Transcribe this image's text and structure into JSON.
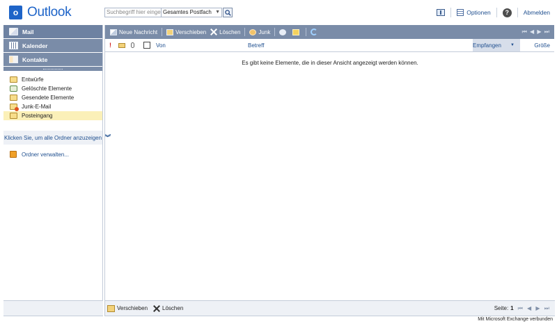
{
  "header": {
    "app_name": "Outlook",
    "logo_letter": "o",
    "search": {
      "placeholder": "Suchbegriff hier eingeben",
      "scope": "Gesamtes Postfach"
    },
    "options_label": "Optionen",
    "help_label": "?",
    "logout_label": "Abmelden"
  },
  "nav": {
    "sections": {
      "mail": "Mail",
      "calendar": "Kalender",
      "contacts": "Kontakte"
    },
    "folders": [
      {
        "label": "Entwürfe"
      },
      {
        "label": "Gelöschte Elemente"
      },
      {
        "label": "Gesendete Elemente"
      },
      {
        "label": "Junk-E-Mail"
      },
      {
        "label": "Posteingang",
        "selected": true
      }
    ],
    "all_folders_label": "Klicken Sie, um alle Ordner anzuzeigen",
    "manage_folders_label": "Ordner verwalten..."
  },
  "toolbar": {
    "new_message": "Neue Nachricht",
    "move": "Verschieben",
    "delete": "Löschen",
    "junk": "Junk",
    "pager_glyphs": "⏮ ◀ ▶ ⏭"
  },
  "columns": {
    "importance": "!",
    "from": "Von",
    "subject": "Betreff",
    "received": "Empfangen",
    "sort_glyph": "▼",
    "size": "Größe"
  },
  "list": {
    "empty_message": "Es gibt keine Elemente, die in dieser Ansicht angezeigt werden können."
  },
  "footer": {
    "move": "Verschieben",
    "delete": "Löschen",
    "page_label": "Seite:",
    "page_number": "1",
    "pager_glyphs": "⏮ ◀ ▶ ⏭"
  },
  "status": {
    "connection": "Mit Microsoft Exchange verbunden"
  },
  "colors": {
    "accent": "#1e64c8",
    "bar": "#7a8ca8",
    "link": "#1f4f8f",
    "selected_row": "#fbf0b8"
  }
}
